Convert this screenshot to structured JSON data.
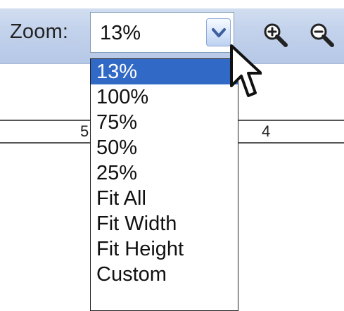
{
  "toolbar": {
    "zoom_label": "Zoom:",
    "selected_zoom": "13%",
    "icons": {
      "dropdown": "chevron-down-icon",
      "zoom_in": "zoom-in-icon",
      "zoom_out": "zoom-out-icon",
      "cursor": "mouse-cursor-icon"
    }
  },
  "canvas": {
    "ruler_values": [
      "5",
      "4"
    ]
  },
  "dropdown": {
    "options": [
      {
        "label": "13%",
        "selected": true
      },
      {
        "label": "100%",
        "selected": false
      },
      {
        "label": "75%",
        "selected": false
      },
      {
        "label": "50%",
        "selected": false
      },
      {
        "label": "25%",
        "selected": false
      },
      {
        "label": "Fit All",
        "selected": false
      },
      {
        "label": "Fit Width",
        "selected": false
      },
      {
        "label": "Fit Height",
        "selected": false
      },
      {
        "label": "Custom",
        "selected": false
      }
    ]
  },
  "colors": {
    "toolbar_blue": "#c4d3ec",
    "selected_option": "#3169c6",
    "dropdown_button_arrow": "#3d5f9f"
  }
}
